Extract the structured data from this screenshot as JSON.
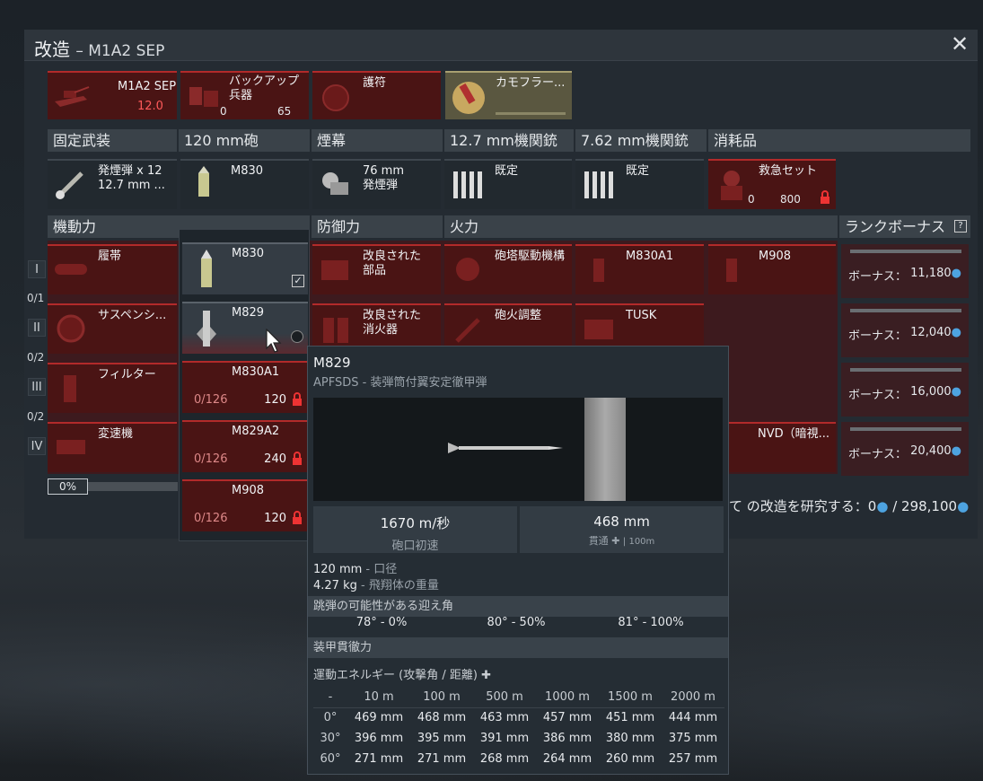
{
  "window": {
    "title": "改造",
    "subtitle": "– M1A2 SEP",
    "close_label": "✕"
  },
  "top_cards": [
    {
      "label": "M1A2 SEP",
      "value": "12.0"
    },
    {
      "label": "バックアップ兵器",
      "count": "0",
      "cost": "65"
    },
    {
      "label": "護符"
    },
    {
      "label": "カモフラー..."
    }
  ],
  "sections_row1": [
    "固定武装",
    "120 mm砲",
    "煙幕",
    "12.7 mm機関銃",
    "7.62 mm機関銃",
    "消耗品"
  ],
  "row1_cards": [
    {
      "label": "発煙弾 x 12",
      "label2": "12.7 mm ..."
    },
    {
      "label": "M830"
    },
    {
      "label": "76 mm",
      "label2": "発煙弾"
    },
    {
      "label": "既定"
    },
    {
      "label": "既定"
    },
    {
      "label": "救急セット",
      "count": "0",
      "cost": "800"
    }
  ],
  "sections_row2": [
    "機動力",
    "防御力",
    "火力",
    "ランクボーナス"
  ],
  "mobility": [
    "履帯",
    "サスペンシ...",
    "フィルター",
    "変速機"
  ],
  "protection": [
    {
      "label": "改良された",
      "label2": "部品"
    },
    {
      "label": "改良された",
      "label2": "消火器"
    }
  ],
  "firepower": [
    {
      "label": "砲塔駆動機構"
    },
    {
      "label": "M830A1"
    },
    {
      "label": "M908"
    },
    {
      "label": "砲火調整"
    },
    {
      "label": "TUSK"
    },
    {
      "label": "NVD（暗視..."
    }
  ],
  "ranks": [
    {
      "roman": "I",
      "frac": "0/1"
    },
    {
      "roman": "II",
      "frac": "0/2"
    },
    {
      "roman": "III",
      "frac": "0/2"
    },
    {
      "roman": "IV",
      "frac": ""
    }
  ],
  "rank_bonus": [
    {
      "label": "ボーナス：",
      "value": "11,180"
    },
    {
      "label": "ボーナス：",
      "value": "12,040"
    },
    {
      "label": "ボーナス：",
      "value": "16,000"
    },
    {
      "label": "ボーナス：",
      "value": "20,400"
    }
  ],
  "dropdown": [
    {
      "label": "M830"
    },
    {
      "label": "M829"
    },
    {
      "label": "M830A1",
      "progress": "0/126",
      "cost": "120"
    },
    {
      "label": "M829A2",
      "progress": "0/126",
      "cost": "240"
    },
    {
      "label": "M908",
      "progress": "0/126",
      "cost": "120"
    }
  ],
  "progress": "0%",
  "research": {
    "text": "て の改造を研究する：0",
    "total": "/ 298,100"
  },
  "tooltip": {
    "name": "M829",
    "type": "APFSDS - 装弾筒付翼安定徹甲弾",
    "velocity_value": "1670 m/秒",
    "velocity_label": "砲口初速",
    "pen_value": "468 mm",
    "pen_label": "貫通",
    "pen_dist": "| 100m",
    "caliber": "120 mm",
    "caliber_label": "- 口径",
    "mass": "4.27 kg",
    "mass_label": "- 飛翔体の重量",
    "ricochet_title": "跳弾の可能性がある迎え角",
    "ricochet": [
      "78° - 0%",
      "80° - 50%",
      "81° - 100%"
    ],
    "armor_title": "装甲貫徹力",
    "kinetic_title": "運動エネルギー (攻撃角 / 距離)",
    "table_headers": [
      "-",
      "10 m",
      "100 m",
      "500 m",
      "1000 m",
      "1500 m",
      "2000 m"
    ],
    "table_rows": [
      [
        "0°",
        "469 mm",
        "468 mm",
        "463 mm",
        "457 mm",
        "451 mm",
        "444 mm"
      ],
      [
        "30°",
        "396 mm",
        "395 mm",
        "391 mm",
        "386 mm",
        "380 mm",
        "375 mm"
      ],
      [
        "60°",
        "271 mm",
        "271 mm",
        "268 mm",
        "264 mm",
        "260 mm",
        "257 mm"
      ]
    ]
  }
}
